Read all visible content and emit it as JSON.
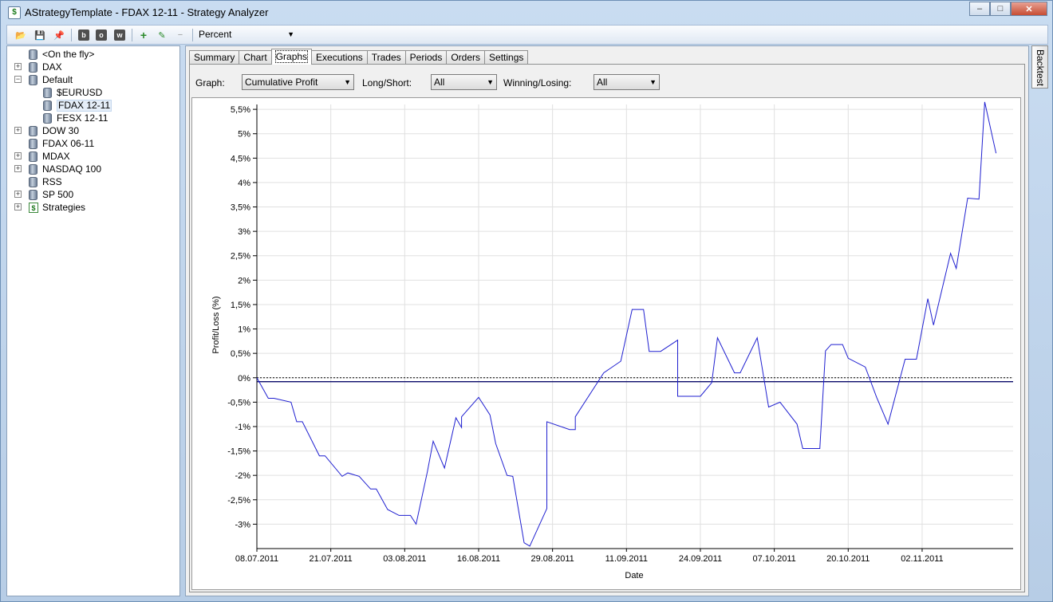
{
  "window": {
    "title": "AStrategyTemplate - FDAX 12-11 - Strategy Analyzer",
    "controls": {
      "minimize": "–",
      "maximize": "□",
      "close": "✕"
    }
  },
  "toolbar": {
    "mode_combo_value": "Percent",
    "buttons": [
      {
        "name": "open-folder-icon",
        "glyph": "📂"
      },
      {
        "name": "save-icon",
        "glyph": "💾"
      },
      {
        "name": "pin-icon",
        "glyph": "📌"
      },
      {
        "name": "b-button",
        "glyph": "b"
      },
      {
        "name": "o-button",
        "glyph": "o"
      },
      {
        "name": "w-button",
        "glyph": "w"
      },
      {
        "name": "add-icon",
        "glyph": "+"
      },
      {
        "name": "edit-icon",
        "glyph": "✎"
      },
      {
        "name": "remove-icon",
        "glyph": "−"
      }
    ]
  },
  "tree": {
    "items": [
      {
        "label": "<On the fly>",
        "indent": 1,
        "expander": "",
        "icon": "db"
      },
      {
        "label": "DAX",
        "indent": 1,
        "expander": "+",
        "icon": "db"
      },
      {
        "label": "Default",
        "indent": 1,
        "expander": "−",
        "icon": "db"
      },
      {
        "label": "$EURUSD",
        "indent": 2,
        "expander": "",
        "icon": "db"
      },
      {
        "label": "FDAX 12-11",
        "indent": 2,
        "expander": "",
        "icon": "db",
        "selected": true
      },
      {
        "label": "FESX 12-11",
        "indent": 2,
        "expander": "",
        "icon": "db"
      },
      {
        "label": "DOW 30",
        "indent": 1,
        "expander": "+",
        "icon": "db"
      },
      {
        "label": "FDAX 06-11",
        "indent": 1,
        "expander": "",
        "icon": "db"
      },
      {
        "label": "MDAX",
        "indent": 1,
        "expander": "+",
        "icon": "db"
      },
      {
        "label": "NASDAQ 100",
        "indent": 1,
        "expander": "+",
        "icon": "db"
      },
      {
        "label": "RSS",
        "indent": 1,
        "expander": "",
        "icon": "db"
      },
      {
        "label": "SP 500",
        "indent": 1,
        "expander": "+",
        "icon": "db"
      },
      {
        "label": "Strategies",
        "indent": 1,
        "expander": "+",
        "icon": "dollar"
      }
    ]
  },
  "tabs": [
    "Summary",
    "Chart",
    "Graphs",
    "Executions",
    "Trades",
    "Periods",
    "Orders",
    "Settings"
  ],
  "active_tab": "Graphs",
  "filters": {
    "graph_label": "Graph:",
    "graph_value": "Cumulative Profit",
    "longshort_label": "Long/Short:",
    "longshort_value": "All",
    "winlose_label": "Winning/Losing:",
    "winlose_value": "All"
  },
  "side_tab": "Backtest",
  "colors": {
    "line": "#1f1fd0",
    "grid": "#e0e0e0",
    "axis": "#000000"
  },
  "chart_data": {
    "type": "line",
    "title": "",
    "xlabel": "Date",
    "ylabel": "Profit/Loss (%)",
    "ylim": [
      -3.5,
      5.6
    ],
    "x_ticks": [
      "08.07.2011",
      "21.07.2011",
      "03.08.2011",
      "16.08.2011",
      "29.08.2011",
      "11.09.2011",
      "24.09.2011",
      "07.10.2011",
      "20.10.2011",
      "02.11.2011"
    ],
    "y_ticks": [
      "5,5%",
      "5%",
      "4,5%",
      "4%",
      "3,5%",
      "3%",
      "2,5%",
      "2%",
      "1,5%",
      "1%",
      "0,5%",
      "0%",
      "-0,5%",
      "-1%",
      "-1,5%",
      "-2%",
      "-2,5%",
      "-3%"
    ],
    "y_tick_values": [
      5.5,
      5,
      4.5,
      4,
      3.5,
      3,
      2.5,
      2,
      1.5,
      1,
      0.5,
      0,
      -0.5,
      -1,
      -1.5,
      -2,
      -2.5,
      -3
    ],
    "zero_line": 0,
    "reference_line": -0.08,
    "series": [
      {
        "x": [
          "2011-07-08",
          "2011-07-10",
          "2011-07-11",
          "2011-07-14",
          "2011-07-15",
          "2011-07-16",
          "2011-07-19",
          "2011-07-20",
          "2011-07-23",
          "2011-07-24",
          "2011-07-26",
          "2011-07-28",
          "2011-07-29",
          "2011-07-31",
          "2011-08-02",
          "2011-08-04",
          "2011-08-05",
          "2011-08-07",
          "2011-08-08",
          "2011-08-10",
          "2011-08-10",
          "2011-08-12",
          "2011-08-13",
          "2011-08-13",
          "2011-08-16",
          "2011-08-18",
          "2011-08-18",
          "2011-08-19",
          "2011-08-21",
          "2011-08-22",
          "2011-08-24",
          "2011-08-24",
          "2011-08-25",
          "2011-08-28",
          "2011-08-28",
          "2011-09-01",
          "2011-09-02",
          "2011-09-02",
          "2011-09-07",
          "2011-09-10",
          "2011-09-10",
          "2011-09-12",
          "2011-09-14",
          "2011-09-15",
          "2011-09-17",
          "2011-09-20",
          "2011-09-20",
          "2011-09-24",
          "2011-09-26",
          "2011-09-27",
          "2011-09-30",
          "2011-10-01",
          "2011-10-04",
          "2011-10-06",
          "2011-10-08",
          "2011-10-11",
          "2011-10-12",
          "2011-10-15",
          "2011-10-16",
          "2011-10-17",
          "2011-10-19",
          "2011-10-20",
          "2011-10-23",
          "2011-10-25",
          "2011-10-27",
          "2011-10-30",
          "2011-11-01",
          "2011-11-03",
          "2011-11-04",
          "2011-11-07",
          "2011-11-08",
          "2011-11-10",
          "2011-11-12",
          "2011-11-13",
          "2011-11-15"
        ],
        "values": [
          0,
          -0.42,
          -0.42,
          -0.5,
          -0.9,
          -0.9,
          -1.6,
          -1.6,
          -2.02,
          -1.95,
          -2.02,
          -2.28,
          -2.28,
          -2.7,
          -2.82,
          -2.82,
          -3.0,
          -1.92,
          -1.3,
          -1.85,
          -1.85,
          -0.82,
          -1.02,
          -0.8,
          -0.4,
          -0.76,
          -0.76,
          -1.35,
          -2.0,
          -2.02,
          -3.38,
          -3.38,
          -3.45,
          -2.68,
          -0.9,
          -1.06,
          -1.06,
          -0.8,
          0.1,
          0.34,
          0.34,
          1.4,
          1.4,
          0.54,
          0.54,
          0.77,
          -0.38,
          -0.38,
          -0.1,
          0.82,
          0.1,
          0.1,
          0.82,
          -0.6,
          -0.5,
          -0.95,
          -1.45,
          -1.45,
          0.55,
          0.68,
          0.68,
          0.4,
          0.22,
          -0.4,
          -0.95,
          0.38,
          0.38,
          1.62,
          1.08,
          2.55,
          2.24,
          3.68,
          3.66,
          5.65,
          4.6
        ]
      }
    ]
  }
}
